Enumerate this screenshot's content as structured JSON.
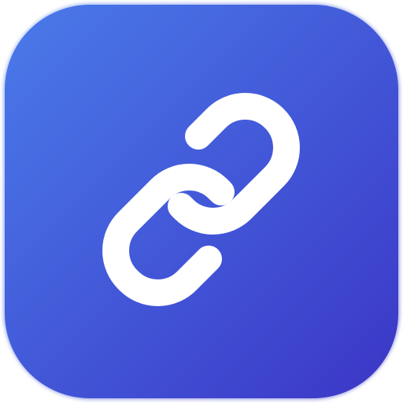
{
  "icon": {
    "name": "link-icon",
    "gradient_start": "#4A7BEA",
    "gradient_end": "#3B36C6",
    "glyph_color": "#FFFFFF"
  }
}
